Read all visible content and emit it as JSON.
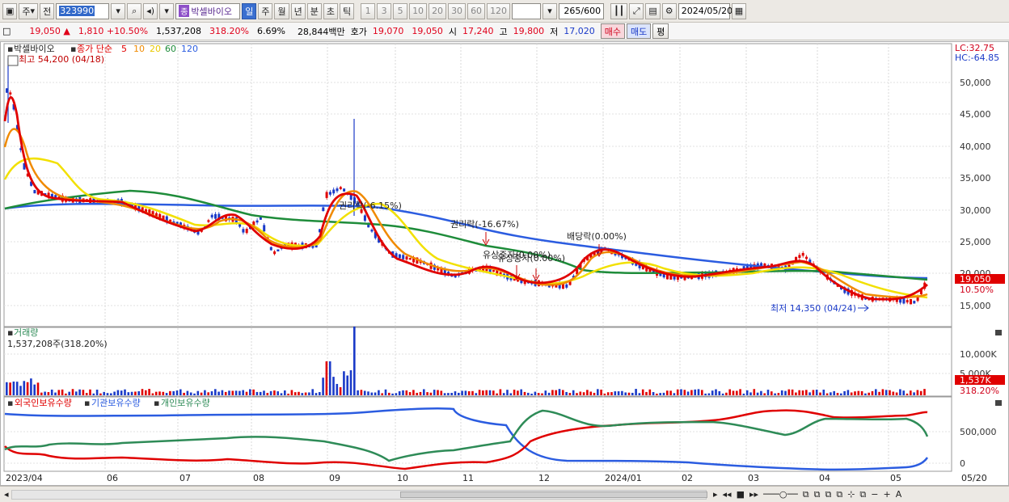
{
  "toolbar": {
    "market_label": "주",
    "prev_label": "전",
    "stock_code": "323990",
    "stock_name_tag": "종",
    "stock_name": "박셀바이오",
    "periods": [
      "일",
      "주",
      "월",
      "년",
      "분",
      "초",
      "틱"
    ],
    "active_period": "일",
    "intervals": [
      "1",
      "3",
      "5",
      "10",
      "20",
      "30",
      "60",
      "120"
    ],
    "count_value": "265",
    "count_max": "/600",
    "date_value": "2024/05/20"
  },
  "quote": {
    "price": "19,050",
    "change": "1,810",
    "change_rate": "+10.50%",
    "volume": "1,537,208",
    "volume_ratio": "318.20%",
    "turnover": "6.69%",
    "amount": "28,844백만",
    "ask_label": "호가",
    "ask": "19,070",
    "bid": "19,050",
    "open_label": "시",
    "open": "17,240",
    "high_label": "고",
    "high": "19,800",
    "low_label": "저",
    "low": "17,020",
    "buy_label": "매수",
    "sell_label": "매도",
    "eval_label": "평"
  },
  "price_panel": {
    "stock_name": "박셀바이오",
    "ma_title": "종가 단순",
    "ma_periods": [
      "5",
      "10",
      "20",
      "60",
      "120"
    ],
    "ma_colors": [
      "#e00000",
      "#f08a00",
      "#f2e000",
      "#1e8c3a",
      "#2b5ce0"
    ],
    "high_note": "최고 54,200 (04/18)",
    "low_note": "최저 14,350 (04/24)",
    "lc": "LC:32.75",
    "hc": "HC:-64.85",
    "last_price": "19,050",
    "last_rate": "10.50%",
    "y_ticks": [
      "50,000",
      "45,000",
      "40,000",
      "35,000",
      "30,000",
      "25,000",
      "20,000",
      "15,000"
    ],
    "y_values": [
      50000,
      45000,
      40000,
      35000,
      30000,
      25000,
      20000,
      15000
    ],
    "events": [
      {
        "label": "권리락(-6.15%)"
      },
      {
        "label": "권리락(-16.67%)"
      },
      {
        "label": "유상증자(0.00%)"
      },
      {
        "label": "유상증자(0.00%)"
      },
      {
        "label": "배당락(0.00%)"
      }
    ]
  },
  "volume_panel": {
    "title": "거래량",
    "summary": "1,537,208주(318.20%)",
    "y_ticks": [
      "10,000K",
      "5,000K"
    ],
    "last_value": "1,537K",
    "last_ratio": "318.20%"
  },
  "holding_panel": {
    "series": [
      {
        "name": "외국인보유수량",
        "color": "#e00000"
      },
      {
        "name": "기관보유수량",
        "color": "#2b5ce0"
      },
      {
        "name": "개인보유수량",
        "color": "#2e8b57"
      }
    ],
    "y_ticks": [
      "500,000",
      "0"
    ]
  },
  "x_axis": [
    "2023/04",
    "06",
    "07",
    "08",
    "09",
    "10",
    "11",
    "12",
    "2024/01",
    "02",
    "03",
    "04",
    "05",
    "05/20"
  ]
}
